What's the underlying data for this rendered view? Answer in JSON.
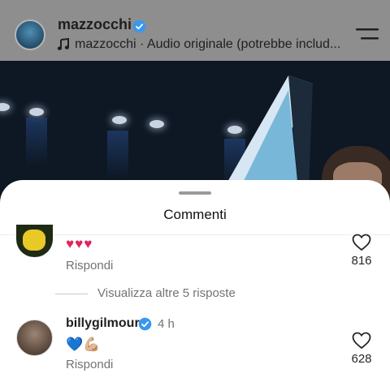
{
  "reel": {
    "username": "mazzocchi",
    "audio": "mazzocchi · Audio originale (potrebbe includ..."
  },
  "comments_sheet": {
    "title": "Commenti",
    "comments": [
      {
        "username": "",
        "text": "♥♥♥",
        "reply_label": "Rispondi",
        "likes": "816"
      },
      {
        "username": "billygilmour",
        "verified": true,
        "time": "4 h",
        "text": "💙💪🏼",
        "reply_label": "Rispondi",
        "likes": "628"
      }
    ],
    "view_more_replies": "Visualizza altre 5 risposte"
  },
  "icons": {
    "verified": "verified-badge-icon",
    "music": "music-note-icon",
    "menu": "menu-icon",
    "like": "heart-outline-icon"
  },
  "colors": {
    "verified": "#3897f0",
    "hearts": "#e0245e",
    "muted_text": "#737373"
  }
}
